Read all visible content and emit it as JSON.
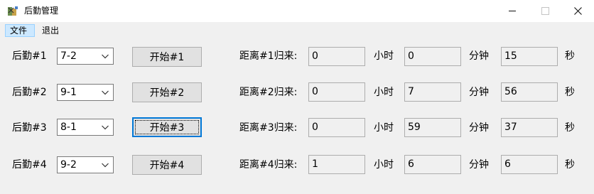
{
  "window": {
    "title": "后勤管理"
  },
  "menu": {
    "file": "文件",
    "exit": "退出"
  },
  "icons": {
    "app": "app-icon",
    "minimize": "minimize-icon",
    "maximize": "maximize-icon",
    "close": "close-icon",
    "dropdown": "chevron-down-icon"
  },
  "rows": [
    {
      "label": "后勤#1",
      "selected": "7-2",
      "button": "开始#1",
      "distance_label": "距离#1归来:",
      "hours": "0",
      "hours_unit": "小时",
      "minutes": "0",
      "minutes_unit": "分钟",
      "seconds": "15",
      "seconds_unit": "秒"
    },
    {
      "label": "后勤#2",
      "selected": "9-1",
      "button": "开始#2",
      "distance_label": "距离#2归来:",
      "hours": "0",
      "hours_unit": "小时",
      "minutes": "7",
      "minutes_unit": "分钟",
      "seconds": "56",
      "seconds_unit": "秒"
    },
    {
      "label": "后勤#3",
      "selected": "8-1",
      "button": "开始#3",
      "distance_label": "距离#3归来:",
      "hours": "0",
      "hours_unit": "小时",
      "minutes": "59",
      "minutes_unit": "分钟",
      "seconds": "37",
      "seconds_unit": "秒"
    },
    {
      "label": "后勤#4",
      "selected": "9-2",
      "button": "开始#4",
      "distance_label": "距离#4归来:",
      "hours": "1",
      "hours_unit": "小时",
      "minutes": "6",
      "minutes_unit": "分钟",
      "seconds": "6",
      "seconds_unit": "秒"
    }
  ]
}
